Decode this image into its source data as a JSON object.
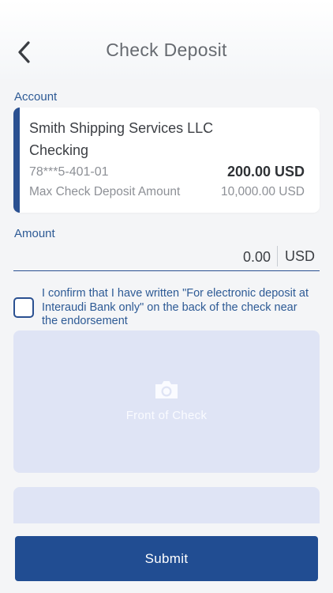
{
  "header": {
    "title": "Check Deposit"
  },
  "account_section": {
    "label": "Account",
    "card": {
      "name": "Smith Shipping Services LLC",
      "type": "Checking",
      "number": "78***5-401-01",
      "balance": "200.00 USD",
      "limit_label": "Max Check Deposit Amount",
      "limit_value": "10,000.00 USD"
    }
  },
  "amount_section": {
    "label": "Amount",
    "value": "0.00",
    "currency": "USD"
  },
  "confirmation": {
    "checked": false,
    "text": "I confirm that I have written \"For electronic deposit at Interaudi Bank only\" on the back of the check near the endorsement"
  },
  "front_check": {
    "label": "Front of Check",
    "icon": "camera-icon"
  },
  "back_check": {
    "label": ""
  },
  "submit": {
    "label": "Submit"
  },
  "colors": {
    "accent": "#2a5091",
    "label_text": "#2d5a95",
    "image_box": "#dfe4f5",
    "button": "#214d92"
  }
}
